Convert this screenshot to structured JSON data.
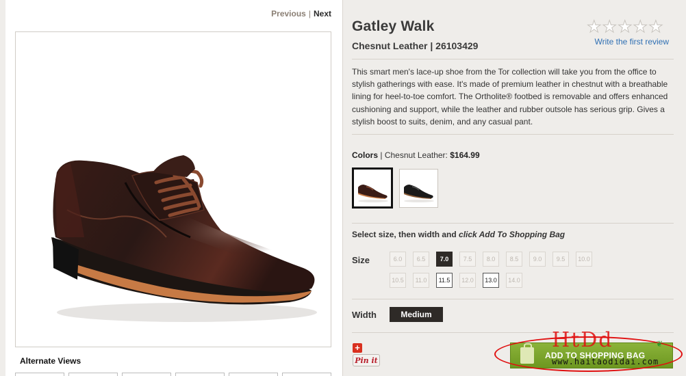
{
  "pager": {
    "previous": "Previous",
    "separator": "|",
    "next": "Next"
  },
  "alternate_views": {
    "title": "Alternate Views"
  },
  "product": {
    "name": "Gatley Walk",
    "subtitle": "Chesnut Leather | 26103429",
    "rating_stars": 5,
    "rating_value": 0,
    "review_link": "Write the first review",
    "description": "This smart men's lace-up shoe from the Tor collection will take you from the office to stylish gatherings with ease. It's made of premium leather in chestnut with a breathable lining for heel-to-toe comfort. The Ortholite® footbed is removable and offers enhanced cushioning and support, while the leather and rubber outsole has serious grip. Gives a stylish boost to suits, denim, and any casual pant."
  },
  "colors": {
    "label": "Colors",
    "separator": "|",
    "selected_name": "Chesnut Leather:",
    "price": "$164.99"
  },
  "size": {
    "instruction_prefix": "Select size, then width and ",
    "instruction_emphasis": "click Add To Shopping Bag",
    "label": "Size",
    "row1": [
      "6.0",
      "6.5",
      "7.0",
      "7.5",
      "8.0",
      "8.5",
      "9.0",
      "9.5",
      "10.0"
    ],
    "row2": [
      "10.5",
      "11.0",
      "11.5",
      "12.0",
      "13.0",
      "14.0"
    ],
    "selected": "7.0",
    "available": [
      "7.0",
      "11.5",
      "13.0"
    ]
  },
  "width": {
    "label": "Width",
    "selected": "Medium"
  },
  "share": {
    "plus": "+",
    "pinit": "Pin it"
  },
  "cart": {
    "add_label": "ADD TO SHOPPING BAG"
  },
  "watermark": {
    "logo": "HtDd",
    "url": "www.haitaodidai.com"
  },
  "colors_theme": {
    "accent_green": "#7aa42a",
    "link_blue": "#2e6fb3",
    "dark": "#2e2a27"
  }
}
